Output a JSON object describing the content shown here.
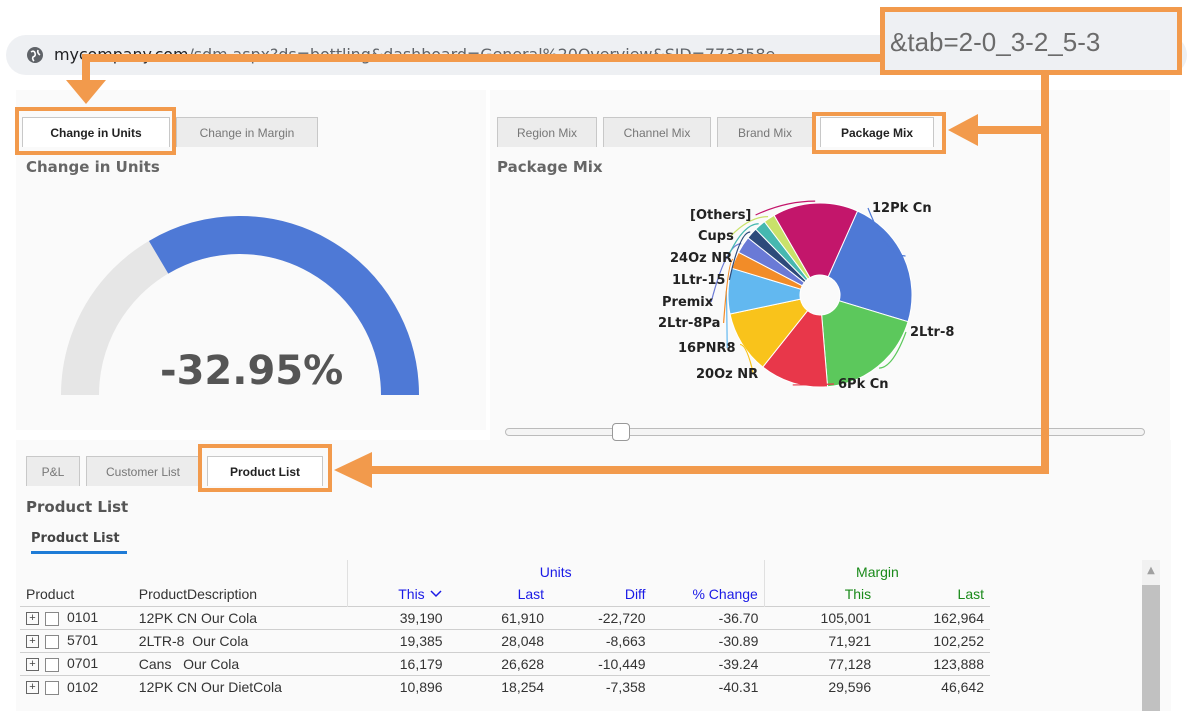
{
  "browser": {
    "url_domain": "mycompany.com",
    "url_path": "/sdm.aspx?ds=bottling&dashboard=General%20Overview&SID=773358e",
    "url_tab_param": "&tab=2-0_3-2_5-3"
  },
  "left_panel": {
    "tabs": [
      "Change in Units",
      "Change in Margin"
    ],
    "title": "Change in Units",
    "gauge_value": "-32.95%",
    "gauge_fraction": 0.33
  },
  "right_panel": {
    "tabs": [
      "Region Mix",
      "Channel Mix",
      "Brand Mix",
      "Package Mix"
    ],
    "title": "Package Mix",
    "pie": {
      "labels": [
        "12Pk Cn",
        "2Ltr-8",
        "6Pk Cn",
        "20Oz NR",
        "16PNR8",
        "2Ltr-8Pa",
        "Premix",
        "1Ltr-15",
        "24Oz NR",
        "Cups",
        "[Others]"
      ],
      "values": [
        23,
        19,
        12,
        11,
        8,
        3,
        3,
        2,
        2,
        2,
        15
      ],
      "colors": [
        "#4e79d6",
        "#5cc85c",
        "#e8374a",
        "#f9c31b",
        "#62b8f0",
        "#f28c28",
        "#6a7ad6",
        "#2d4a7a",
        "#46b8b0",
        "#c9e26a",
        "#c3166b"
      ]
    }
  },
  "bottom_panel": {
    "tabs": [
      "P&L",
      "Customer List",
      "Product List"
    ],
    "title": "Product List",
    "sub_tab": "Product List",
    "table": {
      "group_units": "Units",
      "group_margin": "Margin",
      "columns": [
        "Product",
        "ProductDescription",
        "This",
        "Last",
        "Diff",
        "% Change",
        "This",
        "Last"
      ],
      "sort_icon": "chevron-down-icon",
      "rows": [
        [
          "0101",
          "12PK CN Our Cola",
          "39,190",
          "61,910",
          "-22,720",
          "-36.70",
          "105,001",
          "162,964"
        ],
        [
          "5701",
          "2LTR-8  Our Cola",
          "19,385",
          "28,048",
          "-8,663",
          "-30.89",
          "71,921",
          "102,252"
        ],
        [
          "0701",
          "Cans   Our Cola",
          "16,179",
          "26,628",
          "-10,449",
          "-39.24",
          "77,128",
          "123,888"
        ],
        [
          "0102",
          "12PK CN Our DietCola",
          "10,896",
          "18,254",
          "-7,358",
          "-40.31",
          "29,596",
          "46,642"
        ]
      ]
    }
  },
  "colors": {
    "highlight": "#f29a4c",
    "gauge_fill": "#4e79d6",
    "gauge_track": "#e6e6e6",
    "units_header": "#1a1ae6",
    "margin_header": "#1a8a1a"
  }
}
